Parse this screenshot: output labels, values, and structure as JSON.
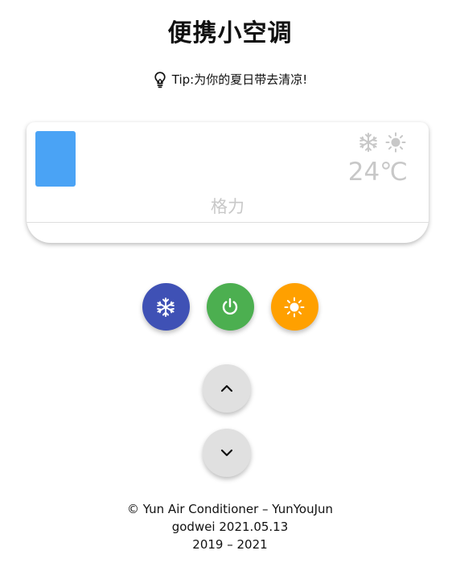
{
  "header": {
    "title": "便携小空调",
    "tip": "Tip:为你的夏日带去清凉!",
    "tip_icon": "lightbulb-icon"
  },
  "air_conditioner": {
    "screen_color": "#4aa3f5",
    "mode_icons": [
      "snowflake-icon",
      "sun-icon"
    ],
    "temperature": "24℃",
    "brand": "格力"
  },
  "controls": {
    "cold_button": {
      "icon": "snowflake-icon",
      "color": "#3f51b5"
    },
    "power_button": {
      "icon": "power-icon",
      "color": "#4caf50"
    },
    "heat_button": {
      "icon": "sun-icon",
      "color": "#ffa000"
    },
    "temp_up": {
      "icon": "chevron-up-icon"
    },
    "temp_down": {
      "icon": "chevron-down-icon"
    }
  },
  "footer": {
    "line1": "© Yun Air Conditioner – YunYouJun",
    "line2": "godwei 2021.05.13",
    "line3": "2019 – 2021"
  }
}
